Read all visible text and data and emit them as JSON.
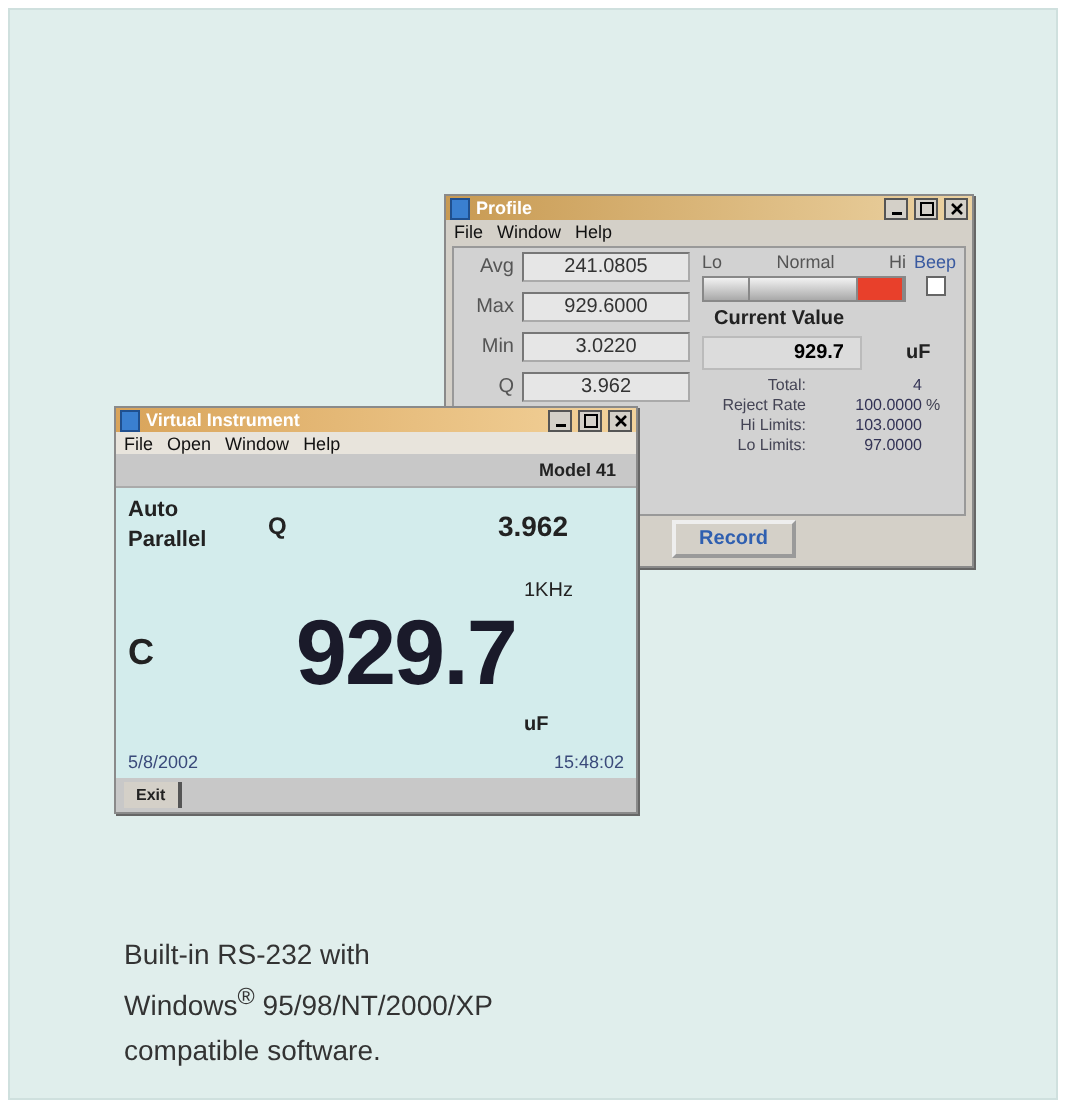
{
  "profile_window": {
    "title": "Profile",
    "menu": [
      "File",
      "Window",
      "Help"
    ],
    "stats": [
      {
        "label": "Avg",
        "value": "241.0805"
      },
      {
        "label": "Max",
        "value": "929.6000"
      },
      {
        "label": "Min",
        "value": "3.0220"
      },
      {
        "label": "Q",
        "value": "3.962"
      }
    ],
    "zones": [
      {
        "label": "Lo",
        "on": false
      },
      {
        "label": "Normal",
        "on": false
      },
      {
        "label": "Hi",
        "on": true
      }
    ],
    "beep": {
      "label": "Beep",
      "checked": false
    },
    "current_value": {
      "title": "Current Value",
      "value": "929.7",
      "unit": "uF"
    },
    "summary": [
      {
        "label": "Total:",
        "value": "4"
      },
      {
        "label": "Reject Rate",
        "value": "100.0000",
        "unit": "%"
      },
      {
        "label": "Hi Limits:",
        "value": "103.0000"
      },
      {
        "label": "Lo Limits:",
        "value": "97.0000"
      }
    ],
    "record_button": "Record"
  },
  "instrument_window": {
    "title": "Virtual Instrument",
    "menu": [
      "File",
      "Open",
      "Window",
      "Help"
    ],
    "model": "Model 41",
    "mode": [
      "Auto",
      "Parallel"
    ],
    "secondary_label": "Q",
    "secondary_value": "3.962",
    "primary_label": "C",
    "primary_value": "929.7",
    "frequency": "1KHz",
    "unit": "uF",
    "date": "5/8/2002",
    "time": "15:48:02",
    "exit_button": "Exit"
  },
  "caption": [
    "Built-in RS-232 with",
    "Windows$^{®}$ 95/98/NT/2000/XP",
    "compatible software."
  ]
}
